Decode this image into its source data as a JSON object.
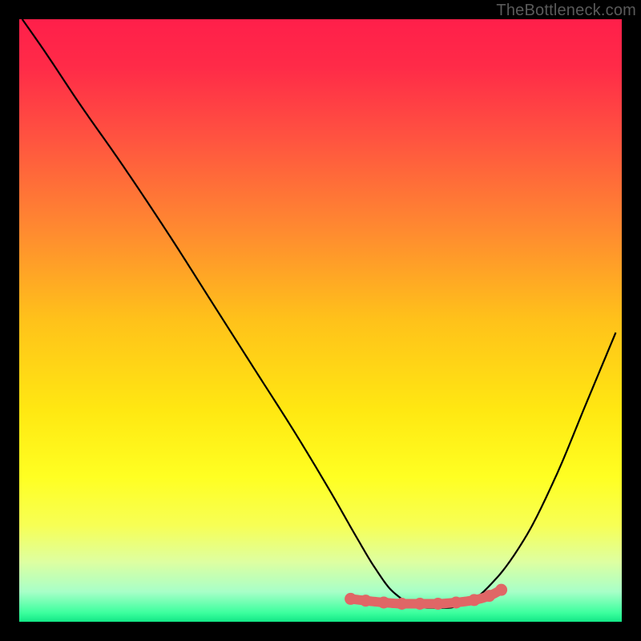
{
  "watermark": {
    "text": "TheBottleneck.com"
  },
  "colors": {
    "background": "#000000",
    "curve": "#000000",
    "marker_fill": "#e06666",
    "marker_stroke": "#e06666"
  },
  "chart_data": {
    "type": "line",
    "title": "",
    "xlabel": "",
    "ylabel": "",
    "xlim": [
      0,
      100
    ],
    "ylim": [
      0,
      100
    ],
    "gradient_stops": [
      {
        "offset": 0.0,
        "color": "#ff1f4a"
      },
      {
        "offset": 0.08,
        "color": "#ff2b48"
      },
      {
        "offset": 0.2,
        "color": "#ff5440"
      },
      {
        "offset": 0.35,
        "color": "#ff8a30"
      },
      {
        "offset": 0.5,
        "color": "#ffc21a"
      },
      {
        "offset": 0.65,
        "color": "#ffe812"
      },
      {
        "offset": 0.76,
        "color": "#ffff22"
      },
      {
        "offset": 0.84,
        "color": "#f7ff55"
      },
      {
        "offset": 0.9,
        "color": "#deffa0"
      },
      {
        "offset": 0.95,
        "color": "#a8ffc8"
      },
      {
        "offset": 0.985,
        "color": "#3dff9e"
      },
      {
        "offset": 1.0,
        "color": "#12e886"
      }
    ],
    "series": [
      {
        "name": "bottleneck-curve",
        "x": [
          0.5,
          4,
          10,
          17,
          25,
          32,
          39,
          46,
          52,
          56,
          59,
          62,
          65,
          68,
          71,
          75,
          79,
          84,
          89,
          94,
          99
        ],
        "y": [
          100,
          95,
          86,
          76,
          64,
          53,
          42,
          31,
          21,
          14,
          9,
          5,
          3,
          2.3,
          2.3,
          3.5,
          7,
          14,
          24,
          36,
          48
        ]
      }
    ],
    "markers": {
      "name": "highlight-segment",
      "x": [
        55,
        57.5,
        60.5,
        63.5,
        66.5,
        69.5,
        72.5,
        75.5,
        78,
        80
      ],
      "y": [
        3.8,
        3.5,
        3.2,
        3.0,
        3.0,
        3.0,
        3.2,
        3.6,
        4.3,
        5.3
      ]
    }
  }
}
